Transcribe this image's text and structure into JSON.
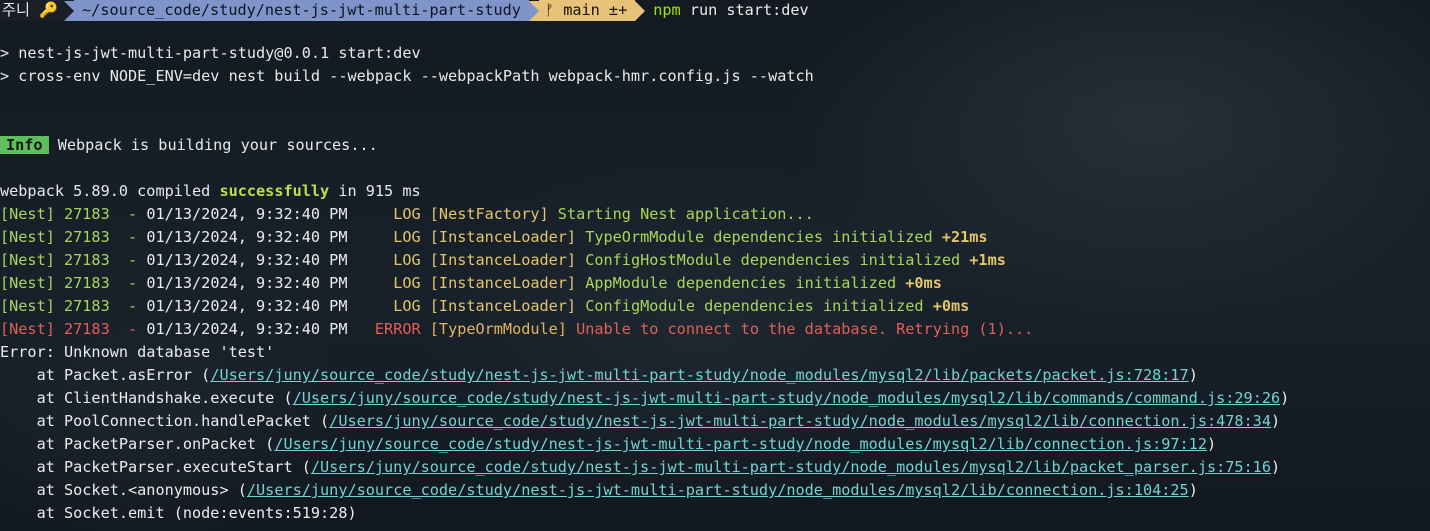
{
  "prompt": {
    "user": "주니",
    "key_icon": "key-icon",
    "path": "~/source_code/study/nest-js-jwt-multi-part-study",
    "branch_icon": "git-branch-icon",
    "branch": "main ±+",
    "command": "npm",
    "command_args": " run start:dev"
  },
  "npm_lines": [
    "> nest-js-jwt-multi-part-study@0.0.1 start:dev",
    "> cross-env NODE_ENV=dev nest build --webpack --webpackPath webpack-hmr.config.js --watch"
  ],
  "info": {
    "badge": "Info",
    "text": " Webpack is building your sources..."
  },
  "compiled": {
    "prefix": "webpack 5.89.0 compiled ",
    "status": "successfully",
    "suffix": " in 915 ms"
  },
  "logs": [
    {
      "tag": "[Nest] 27183  - ",
      "time": "01/13/2024, 9:32:40 PM     ",
      "level": "LOG ",
      "ctx": "[NestFactory] ",
      "msg": "Starting Nest application...",
      "delta": "",
      "kind": "log"
    },
    {
      "tag": "[Nest] 27183  - ",
      "time": "01/13/2024, 9:32:40 PM     ",
      "level": "LOG ",
      "ctx": "[InstanceLoader] ",
      "msg": "TypeOrmModule dependencies initialized ",
      "delta": "+21ms",
      "kind": "log"
    },
    {
      "tag": "[Nest] 27183  - ",
      "time": "01/13/2024, 9:32:40 PM     ",
      "level": "LOG ",
      "ctx": "[InstanceLoader] ",
      "msg": "ConfigHostModule dependencies initialized ",
      "delta": "+1ms",
      "kind": "log"
    },
    {
      "tag": "[Nest] 27183  - ",
      "time": "01/13/2024, 9:32:40 PM     ",
      "level": "LOG ",
      "ctx": "[InstanceLoader] ",
      "msg": "AppModule dependencies initialized ",
      "delta": "+0ms",
      "kind": "log"
    },
    {
      "tag": "[Nest] 27183  - ",
      "time": "01/13/2024, 9:32:40 PM     ",
      "level": "LOG ",
      "ctx": "[InstanceLoader] ",
      "msg": "ConfigModule dependencies initialized ",
      "delta": "+0ms",
      "kind": "log"
    },
    {
      "tag": "[Nest] 27183  - ",
      "time": "01/13/2024, 9:32:40 PM   ",
      "level": "ERROR ",
      "ctx": "[TypeOrmModule] ",
      "msg": "Unable to connect to the database. Retrying (1)...",
      "delta": "",
      "kind": "error"
    }
  ],
  "error_title": "Error: Unknown database 'test'",
  "stack": [
    {
      "pre": "    at Packet.asError (",
      "path": "/Users/juny/source_code/study/nest-js-jwt-multi-part-study/node_modules/mysql2/lib/packets/packet.js:728:17",
      "post": ")"
    },
    {
      "pre": "    at ClientHandshake.execute (",
      "path": "/Users/juny/source_code/study/nest-js-jwt-multi-part-study/node_modules/mysql2/lib/commands/command.js:29:26",
      "post": ")"
    },
    {
      "pre": "    at PoolConnection.handlePacket (",
      "path": "/Users/juny/source_code/study/nest-js-jwt-multi-part-study/node_modules/mysql2/lib/connection.js:478:34",
      "post": ")"
    },
    {
      "pre": "    at PacketParser.onPacket (",
      "path": "/Users/juny/source_code/study/nest-js-jwt-multi-part-study/node_modules/mysql2/lib/connection.js:97:12",
      "post": ")"
    },
    {
      "pre": "    at PacketParser.executeStart (",
      "path": "/Users/juny/source_code/study/nest-js-jwt-multi-part-study/node_modules/mysql2/lib/packet_parser.js:75:16",
      "post": ")"
    },
    {
      "pre": "    at Socket.<anonymous> (",
      "path": "/Users/juny/source_code/study/nest-js-jwt-multi-part-study/node_modules/mysql2/lib/connection.js:104:25",
      "post": ")"
    },
    {
      "pre": "    at Socket.emit (node:events:519:28)",
      "path": "",
      "post": ""
    }
  ]
}
